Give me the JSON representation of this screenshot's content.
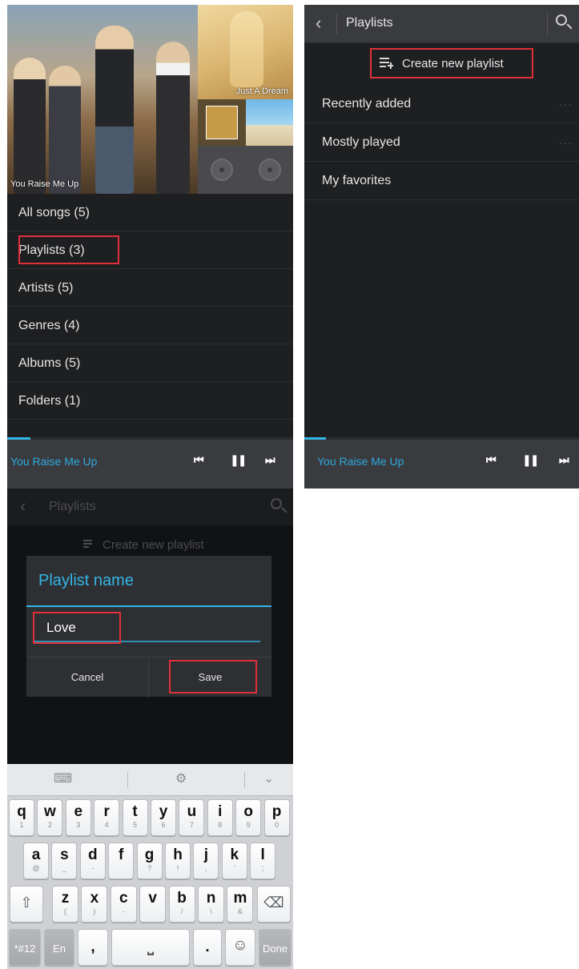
{
  "library": {
    "album_captions": [
      "You Raise Me Up",
      "Just A Dream"
    ],
    "items": [
      {
        "label": "All songs (5)"
      },
      {
        "label": "Playlists (3)"
      },
      {
        "label": "Artists (5)"
      },
      {
        "label": "Genres (4)"
      },
      {
        "label": "Albums (5)"
      },
      {
        "label": "Folders (1)"
      }
    ]
  },
  "now_playing": {
    "title": "You Raise Me Up",
    "progress_fraction": 0.08,
    "controls": {
      "prev": "⏮",
      "pause": "❚❚",
      "next": "⏭"
    }
  },
  "playlists_screen": {
    "title": "Playlists",
    "back_icon": "chevron-left-icon",
    "search_icon": "search-icon",
    "create_label": "Create new playlist",
    "items": [
      {
        "label": "Recently added",
        "more": "···"
      },
      {
        "label": "Mostly played",
        "more": "···"
      },
      {
        "label": "My favorites"
      }
    ]
  },
  "dialog": {
    "title": "Playlist name",
    "input_value": "Love",
    "cancel_label": "Cancel",
    "save_label": "Save"
  },
  "keyboard": {
    "toolbar": [
      "⌨",
      "⚙",
      "⌄"
    ],
    "rows": [
      [
        {
          "k": "q",
          "s": "1"
        },
        {
          "k": "w",
          "s": "2"
        },
        {
          "k": "e",
          "s": "3"
        },
        {
          "k": "r",
          "s": "4"
        },
        {
          "k": "t",
          "s": "5"
        },
        {
          "k": "y",
          "s": "6"
        },
        {
          "k": "u",
          "s": "7"
        },
        {
          "k": "i",
          "s": "8"
        },
        {
          "k": "o",
          "s": "9"
        },
        {
          "k": "p",
          "s": "0"
        }
      ],
      [
        {
          "k": "a",
          "s": "@"
        },
        {
          "k": "s",
          "s": "_"
        },
        {
          "k": "d",
          "s": "-"
        },
        {
          "k": "f",
          "s": ""
        },
        {
          "k": "g",
          "s": "?"
        },
        {
          "k": "h",
          "s": "!"
        },
        {
          "k": "j",
          "s": ","
        },
        {
          "k": "k",
          "s": "'"
        },
        {
          "k": "l",
          "s": ";"
        }
      ],
      [
        {
          "k": "z",
          "s": "("
        },
        {
          "k": "x",
          "s": ")"
        },
        {
          "k": "c",
          "s": "-"
        },
        {
          "k": "v",
          "s": ""
        },
        {
          "k": "b",
          "s": "/"
        },
        {
          "k": "n",
          "s": "\\"
        },
        {
          "k": "m",
          "s": "&"
        }
      ]
    ],
    "shift": "⇧",
    "backspace": "⌫",
    "symbols": "*#12",
    "lang": "En",
    "comma": ",",
    "space": "⎵",
    "period": ".",
    "emoji": "☺",
    "done": "Done"
  }
}
